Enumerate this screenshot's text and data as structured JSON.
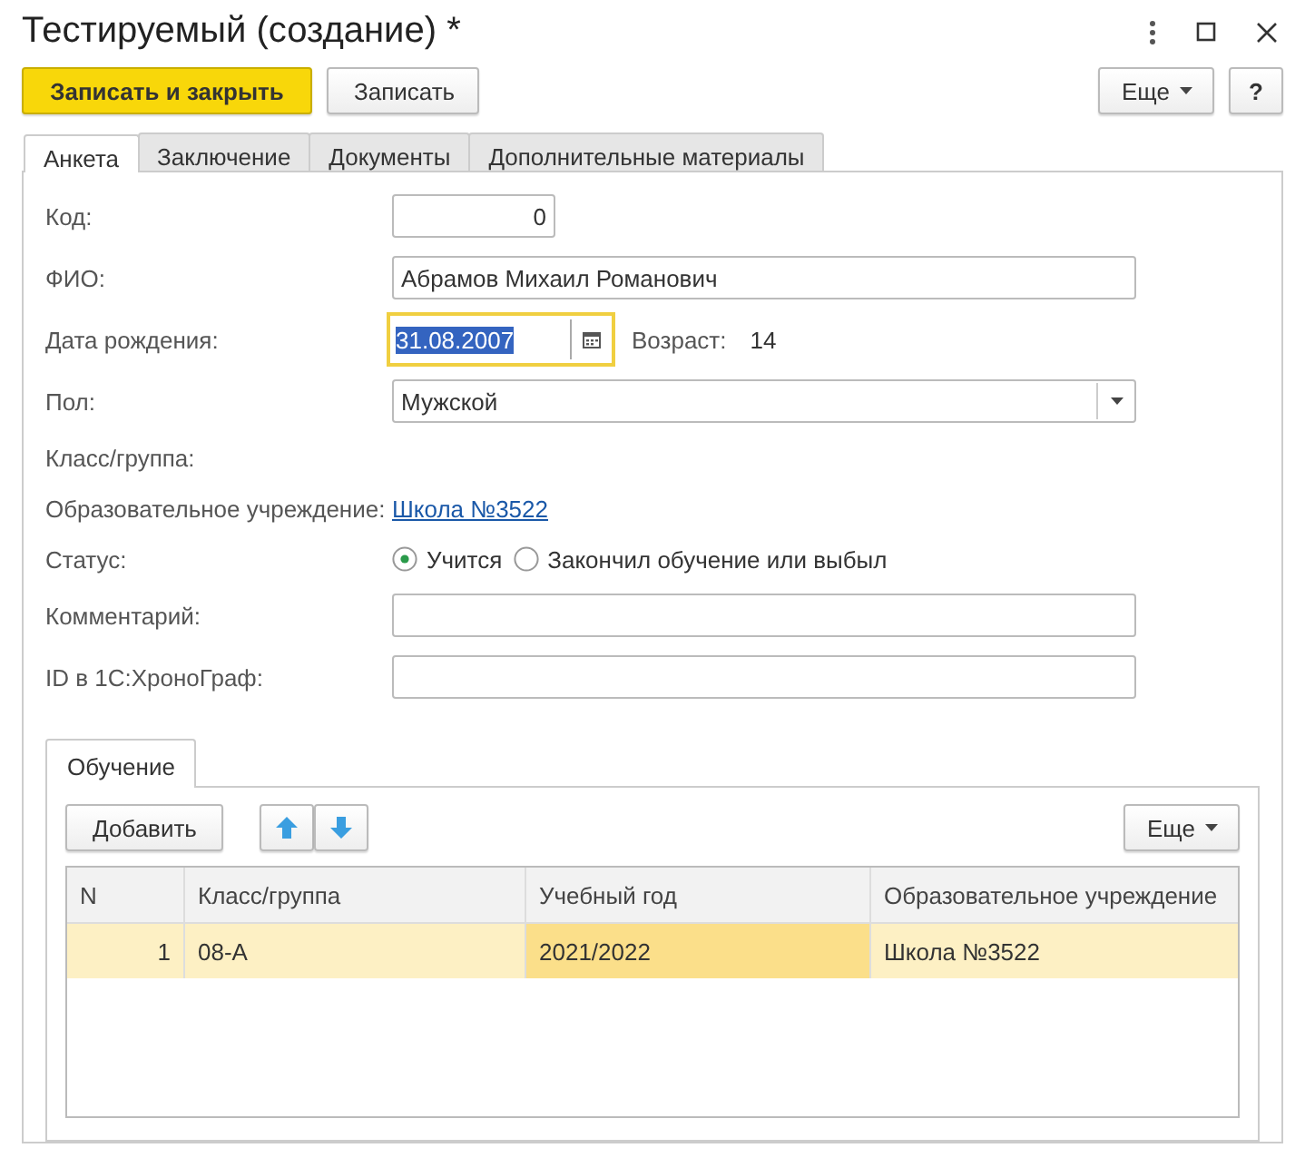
{
  "window": {
    "title": "Тестируемый (создание) *"
  },
  "toolbar": {
    "buttons": [
      {
        "label": "Записать и закрыть",
        "kind": "primary"
      },
      {
        "label": "Записать",
        "kind": "plain"
      }
    ],
    "more": "Еще",
    "help": "?"
  },
  "tabs": [
    {
      "label": "Анкета",
      "selected": true
    },
    {
      "label": "Заключение",
      "selected": false
    },
    {
      "label": "Документы",
      "selected": false
    },
    {
      "label": "Дополнительные материалы",
      "selected": false
    }
  ],
  "fields": [
    {
      "kind": "number",
      "label": "Код:",
      "value": "0"
    },
    {
      "kind": "text",
      "label": "ФИО:",
      "value": "Абрамов Михаил Романович"
    },
    {
      "kind": "date",
      "label": "Дата рождения:",
      "value": "31.08.2007",
      "focused": true,
      "extra_label": "Возраст:",
      "extra_value": "14"
    },
    {
      "kind": "select",
      "label": "Пол:",
      "value": "Мужской"
    },
    {
      "kind": "empty",
      "label": "Класс/группа:"
    },
    {
      "kind": "link",
      "label": "Образовательное учреждение:",
      "value": "Школа №3522"
    },
    {
      "kind": "radio",
      "label": "Статус:",
      "options": [
        {
          "label": "Учится",
          "selected": true
        },
        {
          "label": "Закончил обучение или выбыл",
          "selected": false
        }
      ]
    },
    {
      "kind": "text",
      "label": "Комментарий:"
    },
    {
      "kind": "text",
      "label": "ID в 1С:ХроноГраф:"
    }
  ],
  "sub_tabs": [
    {
      "label": "Обучение",
      "selected": true
    }
  ],
  "sub_toolbar": {
    "add": "Добавить",
    "more": "Еще"
  },
  "table": {
    "columns": [
      "N",
      "Класс/группа",
      "Учебный год",
      "Образовательное учреждение"
    ],
    "rows": [
      {
        "selected": true,
        "cells": [
          {
            "text": "1",
            "current": false
          },
          {
            "text": "08-А",
            "current": false
          },
          {
            "text": "2021/2022",
            "current": true
          },
          {
            "text": "Школа №3522",
            "current": false
          }
        ]
      }
    ]
  }
}
